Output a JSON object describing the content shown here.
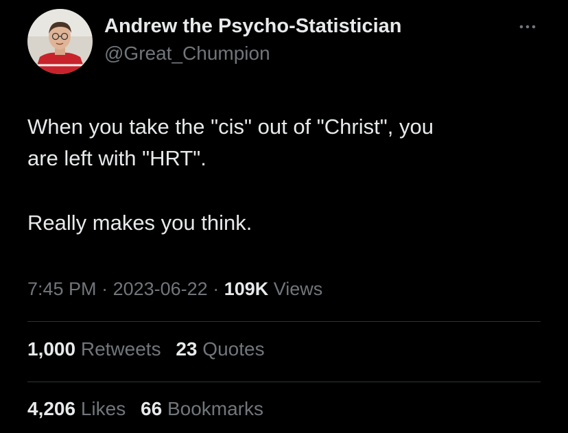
{
  "author": {
    "display_name": "Andrew the Psycho-Statistician",
    "handle": "@Great_Chumpion",
    "avatar_icon": "profile-photo"
  },
  "menu_icon": "more-horizontal-icon",
  "tweet": {
    "line1": "When you take the \"cis\" out of \"Christ\", you",
    "line2": "are left with \"HRT\".",
    "line3": "Really makes you think."
  },
  "meta": {
    "time": "7:45 PM",
    "separator1": " · ",
    "date": "2023-06-22",
    "separator2": " · ",
    "views_count": "109K",
    "views_label": " Views"
  },
  "engagement": {
    "retweets_count": "1,000",
    "retweets_label": "Retweets",
    "quotes_count": "23",
    "quotes_label": "Quotes",
    "likes_count": "4,206",
    "likes_label": "Likes",
    "bookmarks_count": "66",
    "bookmarks_label": "Bookmarks"
  },
  "colors": {
    "background": "#000000",
    "primary_text": "#e7e9ea",
    "secondary_text": "#71767b",
    "divider": "#2f3336"
  }
}
